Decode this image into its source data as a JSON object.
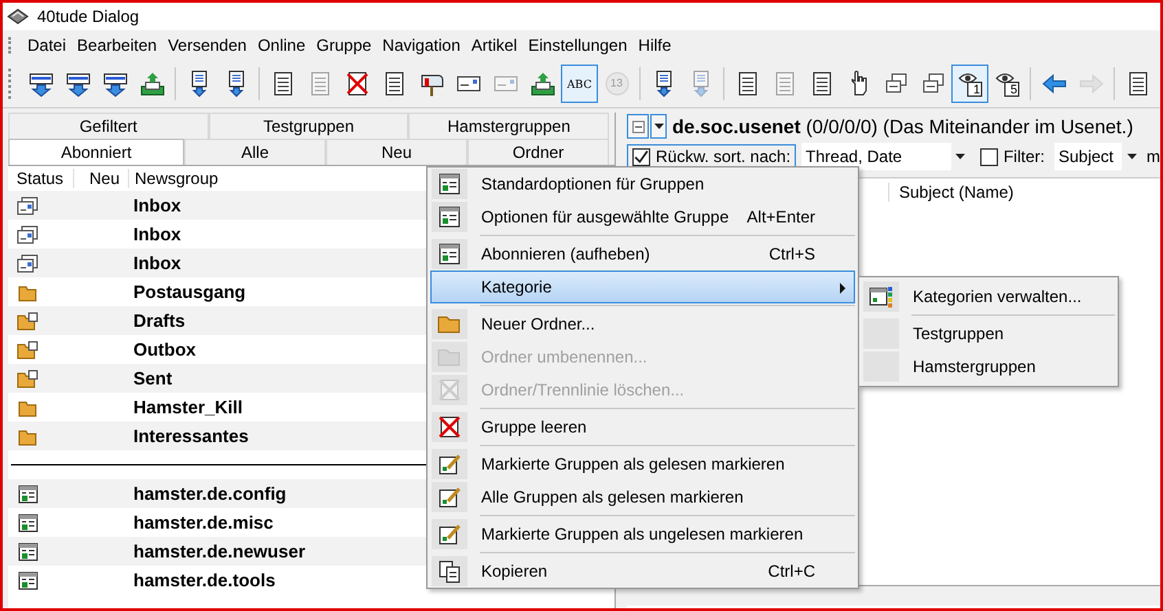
{
  "window": {
    "title": "40tude Dialog"
  },
  "menu_bar": [
    "Datei",
    "Bearbeiten",
    "Versenden",
    "Online",
    "Gruppe",
    "Navigation",
    "Artikel",
    "Einstellungen",
    "Hilfe"
  ],
  "toolbar": [
    {
      "kind": "button",
      "disabled": false,
      "selected": false
    },
    {
      "kind": "button",
      "disabled": false,
      "selected": false
    },
    {
      "kind": "button",
      "disabled": false,
      "selected": false
    },
    {
      "kind": "button",
      "disabled": false,
      "selected": false
    },
    {
      "kind": "separator"
    },
    {
      "kind": "button",
      "disabled": false,
      "selected": false
    },
    {
      "kind": "button",
      "disabled": false,
      "selected": false
    },
    {
      "kind": "separator"
    },
    {
      "kind": "button",
      "disabled": false,
      "selected": false
    },
    {
      "kind": "button",
      "disabled": true,
      "selected": false
    },
    {
      "kind": "button",
      "disabled": false,
      "selected": false
    },
    {
      "kind": "button",
      "disabled": false,
      "selected": false
    },
    {
      "kind": "button",
      "disabled": false,
      "selected": false
    },
    {
      "kind": "button",
      "disabled": false,
      "selected": false
    },
    {
      "kind": "button",
      "disabled": true,
      "selected": false
    },
    {
      "kind": "button",
      "disabled": false,
      "selected": false
    },
    {
      "kind": "button",
      "disabled": false,
      "selected": true,
      "label": "ABC"
    },
    {
      "kind": "button",
      "disabled": true,
      "selected": false,
      "label": "13"
    },
    {
      "kind": "separator"
    },
    {
      "kind": "button",
      "disabled": false,
      "selected": false
    },
    {
      "kind": "button",
      "disabled": true,
      "selected": false
    },
    {
      "kind": "separator"
    },
    {
      "kind": "button",
      "disabled": false,
      "selected": false
    },
    {
      "kind": "button",
      "disabled": true,
      "selected": false
    },
    {
      "kind": "button",
      "disabled": false,
      "selected": false
    },
    {
      "kind": "button",
      "disabled": false,
      "selected": false
    },
    {
      "kind": "button",
      "disabled": false,
      "selected": false
    },
    {
      "kind": "button",
      "disabled": false,
      "selected": false
    },
    {
      "kind": "button",
      "disabled": false,
      "selected": true,
      "label": "1"
    },
    {
      "kind": "button",
      "disabled": false,
      "selected": false,
      "label": "5"
    },
    {
      "kind": "separator"
    },
    {
      "kind": "button",
      "disabled": false,
      "selected": false
    },
    {
      "kind": "button",
      "disabled": true,
      "selected": false
    },
    {
      "kind": "separator"
    },
    {
      "kind": "button",
      "disabled": false,
      "selected": false
    }
  ],
  "tabs": {
    "row_1": [
      {
        "label": "Gefiltert",
        "selected": false
      },
      {
        "label": "Testgruppen",
        "selected": false
      },
      {
        "label": "Hamstergruppen",
        "selected": false
      }
    ],
    "row_2": [
      {
        "label": "Abonniert",
        "selected": true
      },
      {
        "label": "Alle",
        "selected": false
      },
      {
        "label": "Neu",
        "selected": false
      },
      {
        "label": "Ordner",
        "selected": false
      }
    ]
  },
  "newsgroups": {
    "columns": [
      "Status",
      "Neu",
      "Newsgroup"
    ],
    "rows": [
      {
        "kind": "inbox",
        "name": "Inbox"
      },
      {
        "kind": "inbox",
        "name": "Inbox"
      },
      {
        "kind": "inbox",
        "name": "Inbox"
      },
      {
        "kind": "folder",
        "name": "Postausgang"
      },
      {
        "kind": "mailfolder",
        "name": "Drafts"
      },
      {
        "kind": "mailfolder",
        "name": "Outbox"
      },
      {
        "kind": "mailfolder",
        "name": "Sent"
      },
      {
        "kind": "folder",
        "name": "Hamster_Kill"
      },
      {
        "kind": "folder",
        "name": "Interessantes"
      },
      {
        "kind": "separator"
      },
      {
        "kind": "group",
        "name": "hamster.de.config"
      },
      {
        "kind": "group",
        "name": "hamster.de.misc"
      },
      {
        "kind": "group",
        "name": "hamster.de.newuser"
      },
      {
        "kind": "group",
        "name": "hamster.de.tools"
      }
    ]
  },
  "group_header": {
    "title": "**de.soc.usenet** (0/0/0/0) (Das Miteinander im Usenet.)"
  },
  "sort_bar": {
    "reverse_sort": {
      "label": "Rückw. sort. nach:",
      "checked": true
    },
    "sort_value": "Thread, Date",
    "filter": {
      "label": "Filter:",
      "checked": false
    },
    "filter_value": "Subject",
    "column_5": "m"
  },
  "articles": {
    "columns": [
      "Subject (Name)"
    ]
  },
  "context_menu": [
    {
      "kind": "item",
      "label": "Standardoptionen für Gruppen",
      "disabled": false,
      "selected": false
    },
    {
      "kind": "item",
      "label": "Optionen für ausgewählte Gruppe",
      "shortcut": "Alt+Enter",
      "disabled": false,
      "selected": false
    },
    {
      "kind": "separator"
    },
    {
      "kind": "item",
      "label": "Abonnieren (aufheben)",
      "shortcut": "Ctrl+S",
      "disabled": false,
      "selected": false
    },
    {
      "kind": "submenu",
      "label": "Kategorie",
      "disabled": false,
      "selected": true
    },
    {
      "kind": "separator"
    },
    {
      "kind": "item",
      "label": "Neuer Ordner...",
      "disabled": false,
      "selected": false
    },
    {
      "kind": "item",
      "label": "Ordner umbenennen...",
      "disabled": true,
      "selected": false
    },
    {
      "kind": "item",
      "label": "Ordner/Trennlinie löschen...",
      "disabled": true,
      "selected": false
    },
    {
      "kind": "separator"
    },
    {
      "kind": "item",
      "label": "Gruppe leeren",
      "disabled": false,
      "selected": false
    },
    {
      "kind": "separator"
    },
    {
      "kind": "item",
      "label": "Markierte Gruppen als gelesen markieren",
      "disabled": false,
      "selected": false
    },
    {
      "kind": "item",
      "label": "Alle Gruppen als gelesen markieren",
      "disabled": false,
      "selected": false
    },
    {
      "kind": "separator"
    },
    {
      "kind": "item",
      "label": "Markierte Gruppen als ungelesen markieren",
      "disabled": false,
      "selected": false
    },
    {
      "kind": "separator"
    },
    {
      "kind": "item",
      "label": "Kopieren",
      "shortcut": "Ctrl+C",
      "disabled": false,
      "selected": false
    }
  ],
  "submenu": [
    {
      "kind": "item",
      "label": "Kategorien verwalten..."
    },
    {
      "kind": "separator"
    },
    {
      "kind": "item",
      "label": "Testgruppen"
    },
    {
      "kind": "item",
      "label": "Hamstergruppen"
    }
  ]
}
